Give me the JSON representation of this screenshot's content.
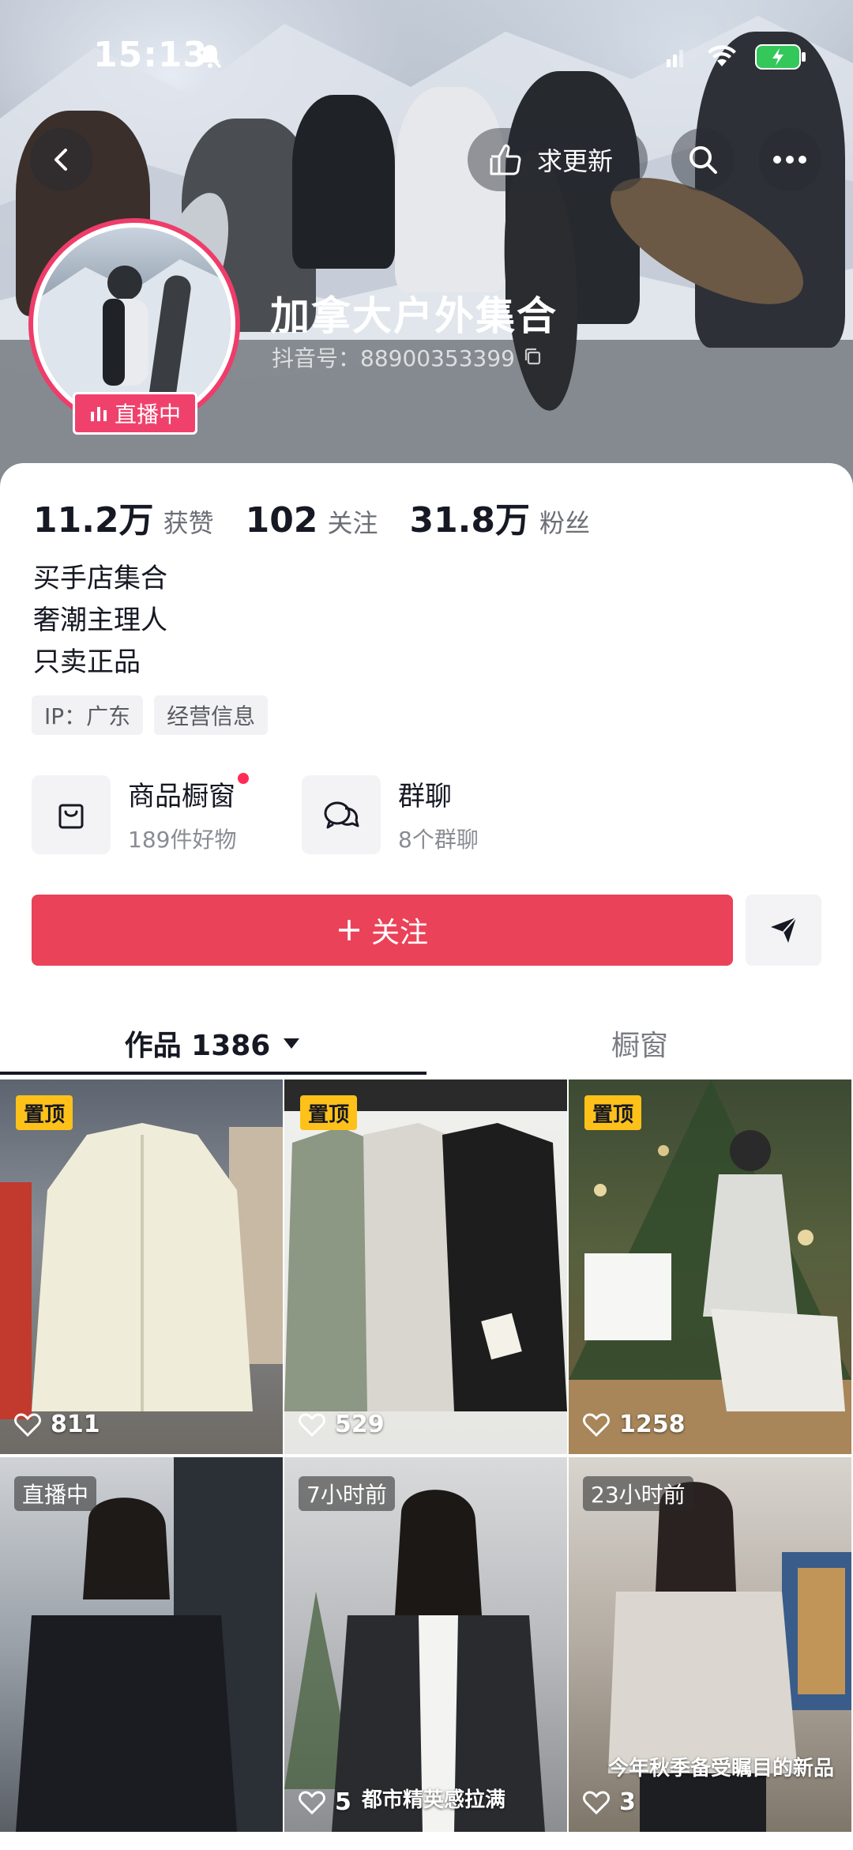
{
  "status_bar": {
    "time": "15:13"
  },
  "header": {
    "request_update_label": "求更新",
    "profile_name": "加拿大户外集合",
    "profile_id": "抖音号：88900353399",
    "live_badge": "直播中"
  },
  "stats": [
    {
      "value": "11.2万",
      "label": "获赞"
    },
    {
      "value": "102",
      "label": "关注"
    },
    {
      "value": "31.8万",
      "label": "粉丝"
    }
  ],
  "bio": [
    "买手店集合",
    "奢潮主理人",
    "只卖正品"
  ],
  "tags": [
    "IP：广东",
    "经营信息"
  ],
  "entries": {
    "shop": {
      "title": "商品橱窗",
      "subtitle": "189件好物"
    },
    "group": {
      "title": "群聊",
      "subtitle": "8个群聊"
    }
  },
  "follow_button": "关注",
  "tabs": {
    "works": "作品 1386",
    "window": "橱窗"
  },
  "posts": [
    {
      "badge": "置顶",
      "likes": "811"
    },
    {
      "badge": "置顶",
      "likes": "529"
    },
    {
      "badge": "置顶",
      "likes": "1258"
    },
    {
      "badge": "直播中",
      "likes": ""
    },
    {
      "badge": "7小时前",
      "likes": "5",
      "caption": "都市精英感拉满"
    },
    {
      "badge": "23小时前",
      "likes": "3",
      "caption": "今年秋季备受瞩目的新品"
    }
  ],
  "colors": {
    "accent": "#ea4258",
    "live_badge": "#f0416c",
    "pin_badge": "#fdc11a"
  }
}
